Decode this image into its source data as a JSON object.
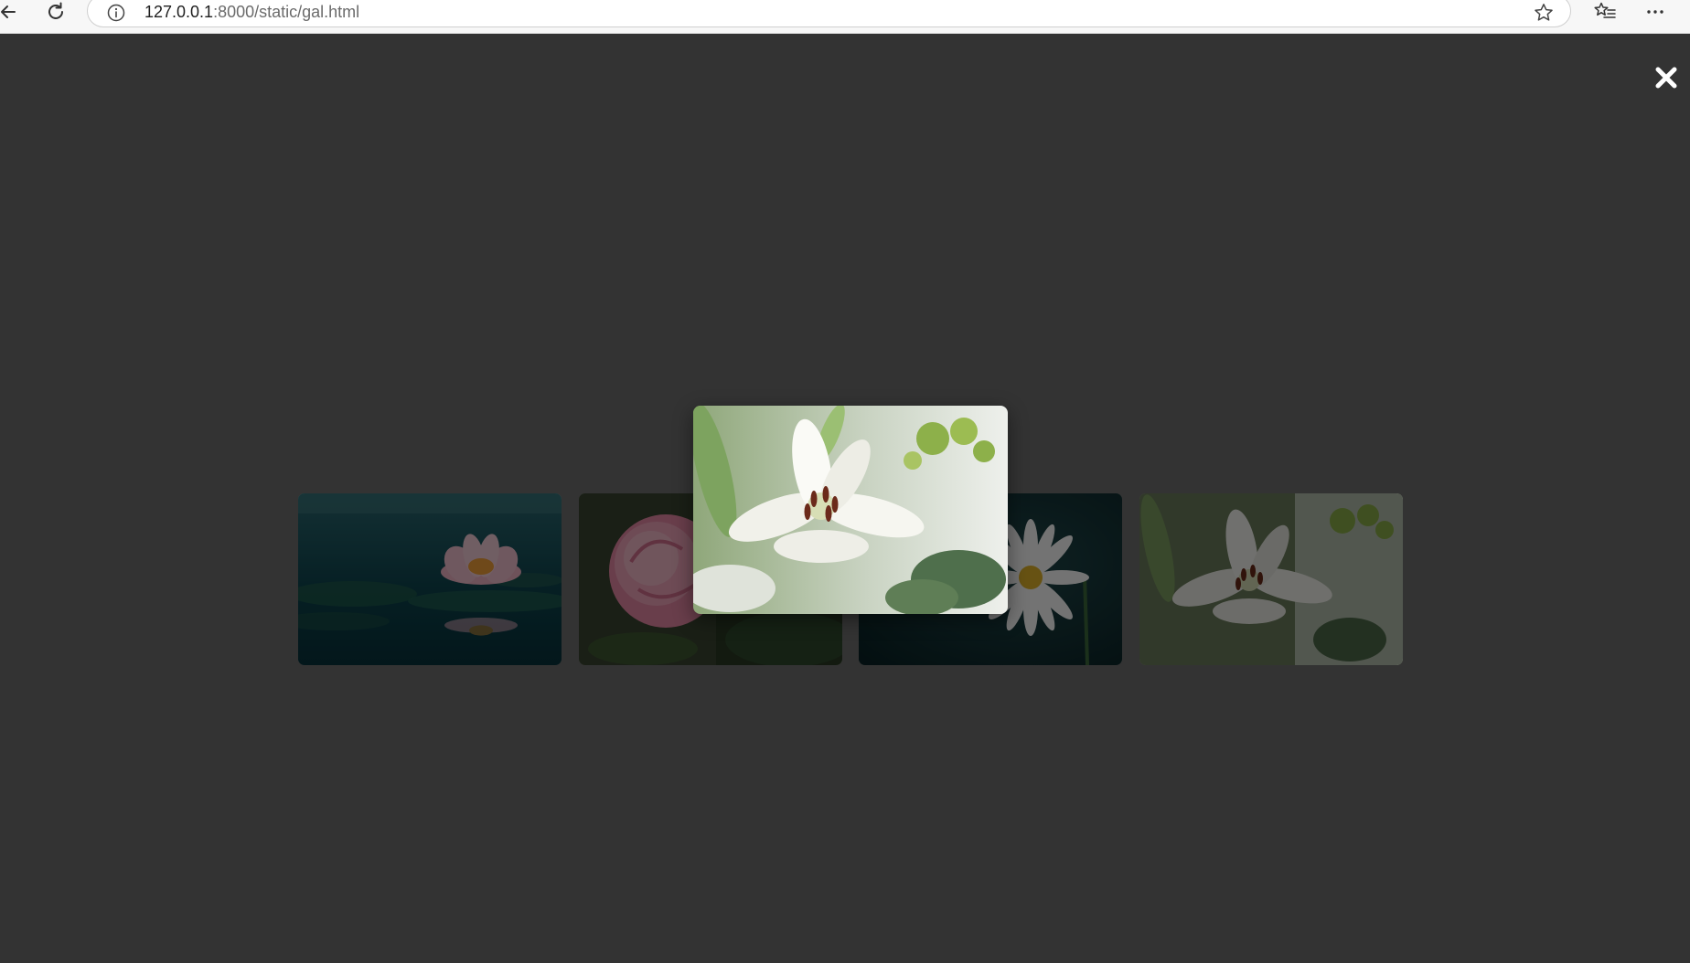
{
  "browser": {
    "url_host": "127.0.0.1",
    "url_rest": ":8000/static/gal.html",
    "icons": {
      "back": "back-arrow-icon",
      "reload": "reload-icon",
      "site_info": "info-circle-icon",
      "favorite": "star-outline-icon",
      "favorites": "favorites-list-icon",
      "more": "more-dots-icon"
    }
  },
  "gallery": {
    "close_icon": "close-x-icon",
    "selected_index": 3,
    "thumbnails": [
      {
        "subject": "water lily",
        "palette": {
          "base": "#0f4a55",
          "accent": "#f2a7c1"
        }
      },
      {
        "subject": "pink rose",
        "palette": {
          "base": "#3a4a2a",
          "accent": "#e88aa6"
        }
      },
      {
        "subject": "white daisy",
        "palette": {
          "base": "#0d2a2e",
          "accent": "#ffffff"
        }
      },
      {
        "subject": "white lily",
        "palette": {
          "base": "#5c6b4a",
          "accent": "#ffffff"
        }
      }
    ],
    "featured": {
      "subject": "white lily",
      "palette": {
        "base": "#7e9b6a",
        "accent": "#ffffff",
        "stamen": "#6b2a1a"
      }
    }
  }
}
